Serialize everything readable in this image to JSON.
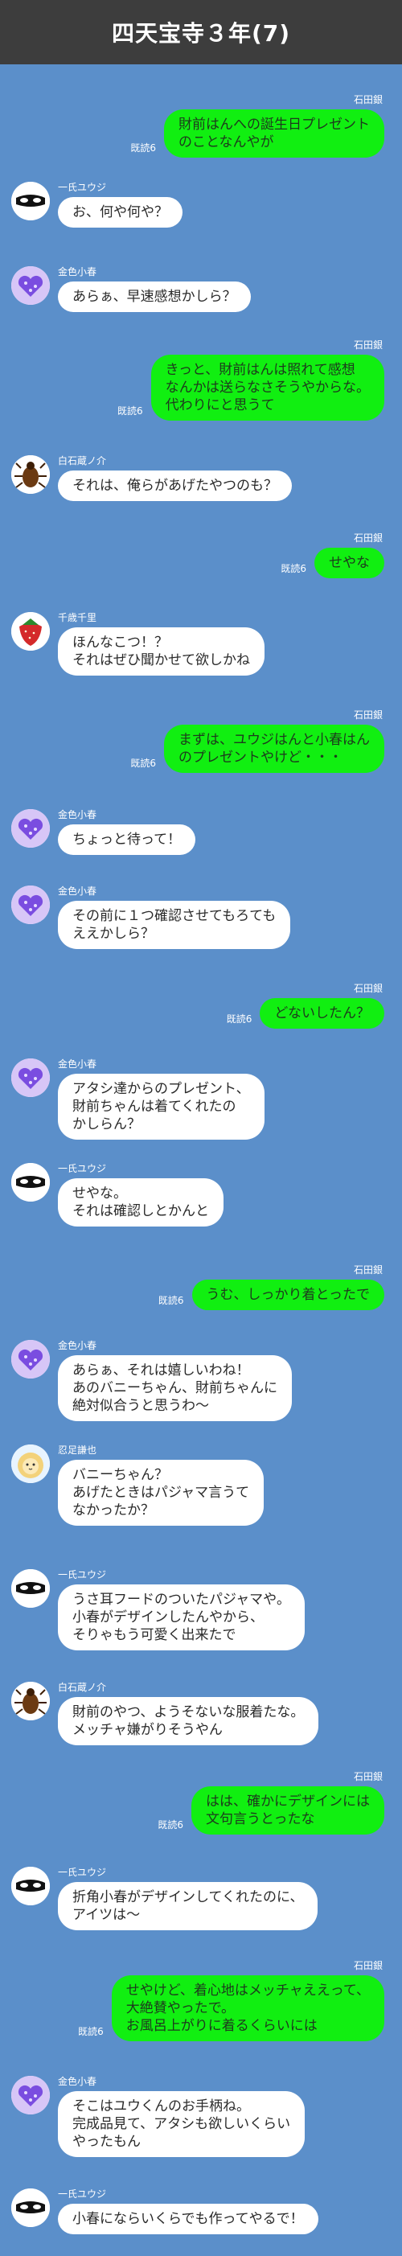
{
  "header": {
    "title": "四天宝寺３年(7)"
  },
  "messages": [
    {
      "side": "right",
      "name": "石田銀",
      "read": "既読6",
      "text": "財前はんへの誕生日プレゼント\nのことなんやが"
    },
    {
      "side": "left",
      "name": "一氏ユウジ",
      "avatar": "mask-icon",
      "text": "お、何や何や？"
    },
    {
      "side": "left",
      "name": "金色小春",
      "avatar": "heart-icon",
      "text": "あらぁ、早速感想かしら？"
    },
    {
      "side": "right",
      "name": "石田銀",
      "read": "既読6",
      "text": "きっと、財前はんは照れて感想\nなんかは送らなさそうやからな。\n代わりにと思うて"
    },
    {
      "side": "left",
      "name": "白石蔵ノ介",
      "avatar": "beetle-icon",
      "text": "それは、俺らがあげたやつのも？"
    },
    {
      "side": "right",
      "name": "石田銀",
      "read": "既読6",
      "text": "せやな"
    },
    {
      "side": "left",
      "name": "千歳千里",
      "avatar": "strawberry-icon",
      "text": "ほんなこつ！？\nそれはぜひ聞かせて欲しかね"
    },
    {
      "side": "right",
      "name": "石田銀",
      "read": "既読6",
      "text": "まずは、ユウジはんと小春はん\nのプレゼントやけど・・・"
    },
    {
      "side": "left",
      "name": "金色小春",
      "avatar": "heart-icon",
      "text": "ちょっと待って！"
    },
    {
      "side": "left",
      "name": "金色小春",
      "avatar": "heart-icon",
      "text": "その前に１つ確認させてもろても\nええかしら？"
    },
    {
      "side": "right",
      "name": "石田銀",
      "read": "既読6",
      "text": "どないしたん？"
    },
    {
      "side": "left",
      "name": "金色小春",
      "avatar": "heart-icon",
      "text": "アタシ達からのプレゼント、\n財前ちゃんは着てくれたの\nかしらん？"
    },
    {
      "side": "left",
      "name": "一氏ユウジ",
      "avatar": "mask-icon",
      "text": "せやな。\nそれは確認しとかんと"
    },
    {
      "side": "right",
      "name": "石田銀",
      "read": "既読6",
      "text": "うむ、しっかり着とったで"
    },
    {
      "side": "left",
      "name": "金色小春",
      "avatar": "heart-icon",
      "text": "あらぁ、それは嬉しいわね！\nあのバニーちゃん、財前ちゃんに\n絶対似合うと思うわ〜"
    },
    {
      "side": "left",
      "name": "忍足謙也",
      "avatar": "lion-icon",
      "text": "バニーちゃん？\nあげたときはパジャマ言うて\nなかったか？"
    },
    {
      "side": "left",
      "name": "一氏ユウジ",
      "avatar": "mask-icon",
      "text": "うさ耳フードのついたパジャマや。\n小春がデザインしたんやから、\nそりゃもう可愛く出来たで"
    },
    {
      "side": "left",
      "name": "白石蔵ノ介",
      "avatar": "beetle-icon",
      "text": "財前のやつ、ようそないな服着たな。\nメッチャ嫌がりそうやん"
    },
    {
      "side": "right",
      "name": "石田銀",
      "read": "既読6",
      "text": "はは、確かにデザインには\n文句言うとったな"
    },
    {
      "side": "left",
      "name": "一氏ユウジ",
      "avatar": "mask-icon",
      "text": "折角小春がデザインしてくれたのに、\nアイツは〜"
    },
    {
      "side": "right",
      "name": "石田銀",
      "read": "既読6",
      "text": "せやけど、着心地はメッチャええって、\n大絶賛やったで。\nお風呂上がりに着るくらいには"
    },
    {
      "side": "left",
      "name": "金色小春",
      "avatar": "heart-icon",
      "text": "そこはユウくんのお手柄ね。\n完成品見て、アタシも欲しいくらい\nやったもん"
    },
    {
      "side": "left",
      "name": "一氏ユウジ",
      "avatar": "mask-icon",
      "text": "小春にならいくらでも作ってやるで！"
    }
  ]
}
